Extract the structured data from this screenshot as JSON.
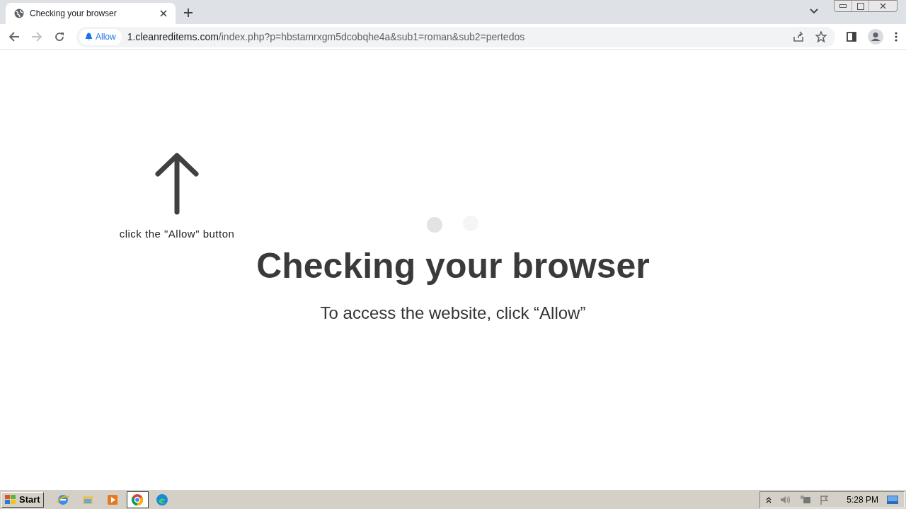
{
  "tabs": [
    {
      "title": "Checking your browser",
      "selected": true
    }
  ],
  "address_bar": {
    "permission_chip": "Allow",
    "host": "1.cleanreditems.com",
    "path": "/index.php?p=hbstamrxgm5dcobqhe4a&sub1=roman&sub2=pertedos"
  },
  "page": {
    "hint": "click the \"Allow\" button",
    "heading": "Checking your browser",
    "subtitle": "To access the website, click “Allow”"
  },
  "taskbar": {
    "start": "Start",
    "apps": [
      {
        "kind": "ie",
        "selected": false
      },
      {
        "kind": "folder",
        "selected": false
      },
      {
        "kind": "media",
        "selected": false
      },
      {
        "kind": "chrome",
        "selected": true
      },
      {
        "kind": "edge",
        "selected": false
      }
    ],
    "clock": "5:28 PM"
  }
}
